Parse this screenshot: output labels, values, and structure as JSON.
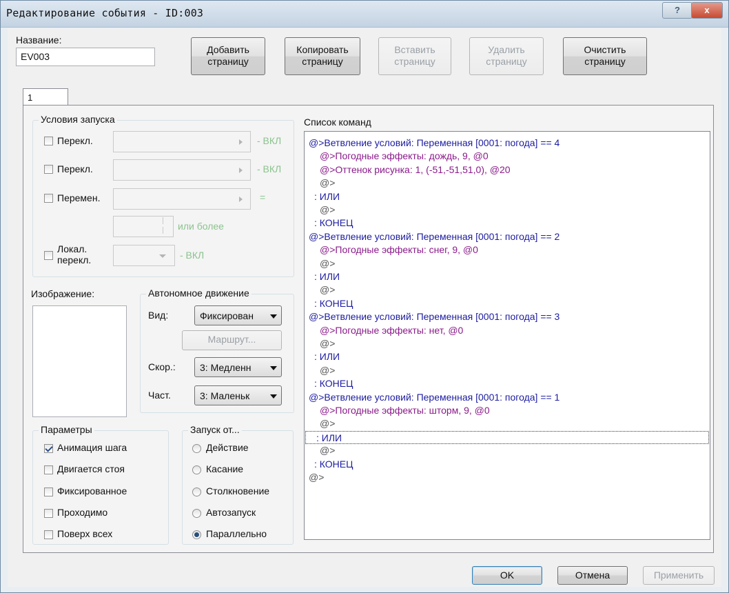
{
  "window": {
    "title": "Редактирование события - ID:003",
    "help_label": "?",
    "close_label": "x"
  },
  "name_section": {
    "label": "Название:",
    "value": "EV003"
  },
  "page_buttons": [
    {
      "line1": "Добавить",
      "line2": "страницу",
      "enabled": true
    },
    {
      "line1": "Копировать",
      "line2": "страницу",
      "enabled": true
    },
    {
      "line1": "Вставить",
      "line2": "страницу",
      "enabled": false
    },
    {
      "line1": "Удалить",
      "line2": "страницу",
      "enabled": false
    },
    {
      "line1": "Очистить",
      "line2": "страницу",
      "enabled": true
    }
  ],
  "tabs": [
    {
      "label": "1",
      "selected": true
    }
  ],
  "conditions": {
    "title": "Условия запуска",
    "switch1_label": "Перекл.",
    "switch1_suffix": "- ВКЛ",
    "switch2_label": "Перекл.",
    "switch2_suffix": "- ВКЛ",
    "variable_label": "Перемен.",
    "variable_suffix": "=",
    "or_more_label": "или более",
    "local_line1": "Локал.",
    "local_line2": "перекл.",
    "local_suffix": "- ВКЛ"
  },
  "image_section": {
    "label": "Изображение:"
  },
  "autonomous": {
    "title": "Автономное движение",
    "type_label": "Вид:",
    "type_value": "Фиксирован",
    "route_button": "Маршрут...",
    "speed_label": "Скор.:",
    "speed_value": "3: Медленн",
    "freq_label": "Част.",
    "freq_value": "3: Маленьк"
  },
  "params": {
    "title": "Параметры",
    "items": [
      {
        "label": "Анимация шага",
        "checked": true
      },
      {
        "label": "Двигается стоя",
        "checked": false
      },
      {
        "label": "Фиксированное",
        "checked": false
      },
      {
        "label": "Проходимо",
        "checked": false
      },
      {
        "label": "Поверх всех",
        "checked": false
      }
    ]
  },
  "trigger": {
    "title": "Запуск от...",
    "items": [
      {
        "label": "Действие",
        "selected": false
      },
      {
        "label": "Касание",
        "selected": false
      },
      {
        "label": "Столкновение",
        "selected": false
      },
      {
        "label": "Автозапуск",
        "selected": false
      },
      {
        "label": "Параллельно",
        "selected": true
      }
    ]
  },
  "command_list": {
    "label": "Список команд",
    "colors": {
      "branch": "#1c1ca0",
      "action": "#8a1a8a",
      "plain": "#555555"
    },
    "lines": [
      {
        "text": "@>Ветвление условий: Переменная [0001: погода] == 4",
        "indent": 0,
        "style": "blue"
      },
      {
        "text": "@>Погодные эффекты: дождь, 9, @0",
        "indent": 1,
        "style": "purple"
      },
      {
        "text": "@>Оттенок рисунка: 1, (-51,-51,51,0), @20",
        "indent": 1,
        "style": "purple"
      },
      {
        "text": "@>",
        "indent": 1,
        "style": "gray"
      },
      {
        "text": ": ИЛИ",
        "indent": 0.5,
        "style": "blue"
      },
      {
        "text": "@>",
        "indent": 1,
        "style": "gray"
      },
      {
        "text": ": КОНЕЦ",
        "indent": 0.5,
        "style": "blue"
      },
      {
        "text": "@>Ветвление условий: Переменная [0001: погода] == 2",
        "indent": 0,
        "style": "blue"
      },
      {
        "text": "@>Погодные эффекты: снег, 9, @0",
        "indent": 1,
        "style": "purple"
      },
      {
        "text": "@>",
        "indent": 1,
        "style": "gray"
      },
      {
        "text": ": ИЛИ",
        "indent": 0.5,
        "style": "blue"
      },
      {
        "text": "@>",
        "indent": 1,
        "style": "gray"
      },
      {
        "text": ": КОНЕЦ",
        "indent": 0.5,
        "style": "blue"
      },
      {
        "text": "@>Ветвление условий: Переменная [0001: погода] == 3",
        "indent": 0,
        "style": "blue"
      },
      {
        "text": "@>Погодные эффекты: нет, @0",
        "indent": 1,
        "style": "purple"
      },
      {
        "text": "@>",
        "indent": 1,
        "style": "gray"
      },
      {
        "text": ": ИЛИ",
        "indent": 0.5,
        "style": "blue"
      },
      {
        "text": "@>",
        "indent": 1,
        "style": "gray"
      },
      {
        "text": ": КОНЕЦ",
        "indent": 0.5,
        "style": "blue"
      },
      {
        "text": "@>Ветвление условий: Переменная [0001: погода] == 1",
        "indent": 0,
        "style": "blue"
      },
      {
        "text": "@>Погодные эффекты: шторм, 9, @0",
        "indent": 1,
        "style": "purple"
      },
      {
        "text": "@>",
        "indent": 1,
        "style": "gray"
      },
      {
        "text": ": ИЛИ",
        "indent": 0.5,
        "style": "blue",
        "selected": true
      },
      {
        "text": "@>",
        "indent": 1,
        "style": "gray"
      },
      {
        "text": ": КОНЕЦ",
        "indent": 0.5,
        "style": "blue"
      },
      {
        "text": "@>",
        "indent": 0,
        "style": "gray"
      }
    ]
  },
  "dialog_buttons": {
    "ok": "OK",
    "cancel": "Отмена",
    "apply": "Применить"
  }
}
